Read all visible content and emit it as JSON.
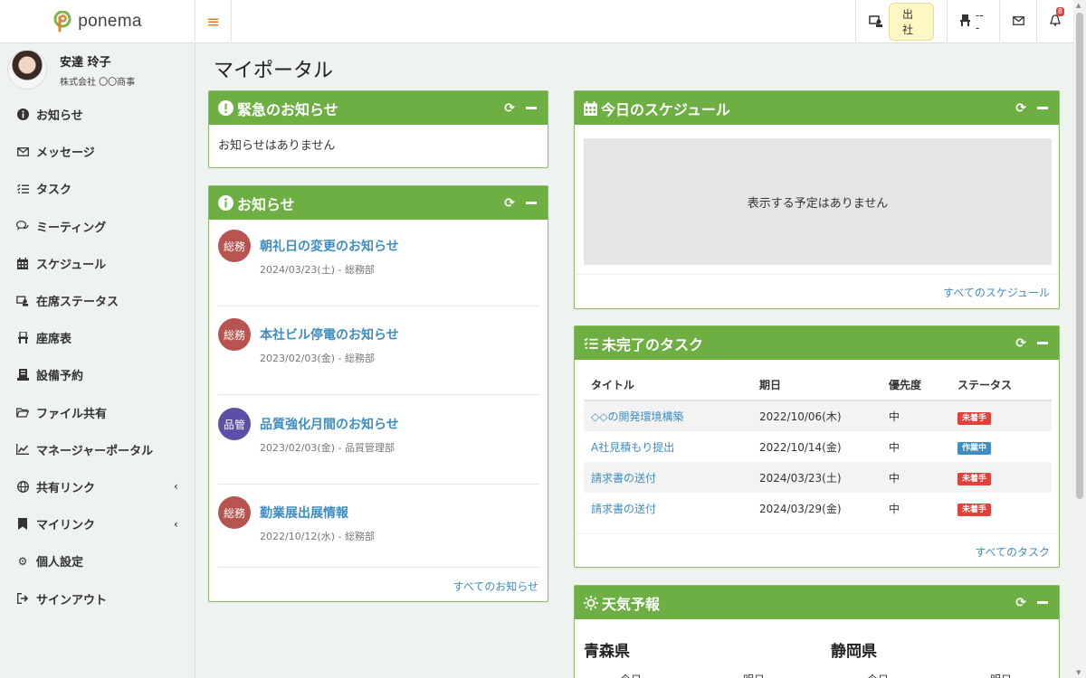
{
  "brand": {
    "name": "ponema"
  },
  "topbar": {
    "status_label": "出社",
    "seat_label": "---",
    "notification_count": "8"
  },
  "user": {
    "name": "安達 玲子",
    "company": "株式会社 〇〇商事"
  },
  "sidebar": {
    "items": [
      {
        "label": "お知らせ",
        "icon": "info-circle-icon"
      },
      {
        "label": "メッセージ",
        "icon": "envelope-icon"
      },
      {
        "label": "タスク",
        "icon": "checklist-icon"
      },
      {
        "label": "ミーティング",
        "icon": "chat-icon"
      },
      {
        "label": "スケジュール",
        "icon": "calendar-icon"
      },
      {
        "label": "在席ステータス",
        "icon": "presence-icon"
      },
      {
        "label": "座席表",
        "icon": "chair-icon"
      },
      {
        "label": "設備予約",
        "icon": "facility-icon"
      },
      {
        "label": "ファイル共有",
        "icon": "folder-icon"
      },
      {
        "label": "マネージャーポータル",
        "icon": "chart-icon"
      },
      {
        "label": "共有リンク",
        "icon": "globe-icon"
      },
      {
        "label": "マイリンク",
        "icon": "bookmark-icon"
      },
      {
        "label": "個人設定",
        "icon": "gear-icon"
      },
      {
        "label": "サインアウト",
        "icon": "sign-out-icon"
      }
    ]
  },
  "page": {
    "title": "マイポータル"
  },
  "urgent": {
    "title": "緊急のお知らせ",
    "empty_text": "お知らせはありません"
  },
  "news": {
    "title": "お知らせ",
    "items": [
      {
        "badge": "総務",
        "badge_color": "#b85450",
        "title": "朝礼日の変更のお知らせ",
        "meta": "2024/03/23(土) - 総務部"
      },
      {
        "badge": "総務",
        "badge_color": "#b85450",
        "title": "本社ビル停電のお知らせ",
        "meta": "2023/02/03(金) - 総務部"
      },
      {
        "badge": "品管",
        "badge_color": "#5b4fa8",
        "title": "品質強化月間のお知らせ",
        "meta": "2023/02/03(金) - 品質管理部"
      },
      {
        "badge": "総務",
        "badge_color": "#b85450",
        "title": "勤業展出展情報",
        "meta": "2022/10/12(水) - 総務部"
      }
    ],
    "all_link": "すべてのお知らせ"
  },
  "schedule": {
    "title": "今日のスケジュール",
    "empty_text": "表示する予定はありません",
    "all_link": "すべてのスケジュール"
  },
  "tasks": {
    "title": "未完了のタスク",
    "columns": [
      "タイトル",
      "期日",
      "優先度",
      "ステータス"
    ],
    "rows": [
      {
        "title": "◇◇の開発環境構築",
        "due": "2022/10/06(木)",
        "priority": "中",
        "status": "未着手",
        "status_color": "#e0413a"
      },
      {
        "title": "A社見積もり提出",
        "due": "2022/10/14(金)",
        "priority": "中",
        "status": "作業中",
        "status_color": "#3f8ec1"
      },
      {
        "title": "請求書の送付",
        "due": "2024/03/23(土)",
        "priority": "中",
        "status": "未着手",
        "status_color": "#e0413a"
      },
      {
        "title": "請求書の送付",
        "due": "2024/03/29(金)",
        "priority": "中",
        "status": "未着手",
        "status_color": "#e0413a"
      }
    ],
    "all_link": "すべてのタスク"
  },
  "weather": {
    "title": "天気予報",
    "prefectures": [
      "青森県",
      "静岡県"
    ],
    "days": [
      "今日",
      "明日",
      "今日",
      "明日"
    ]
  },
  "colors": {
    "card_header": "#6eaf44",
    "link": "#3f8ec1",
    "menu_toggle": "#e07a2a"
  }
}
